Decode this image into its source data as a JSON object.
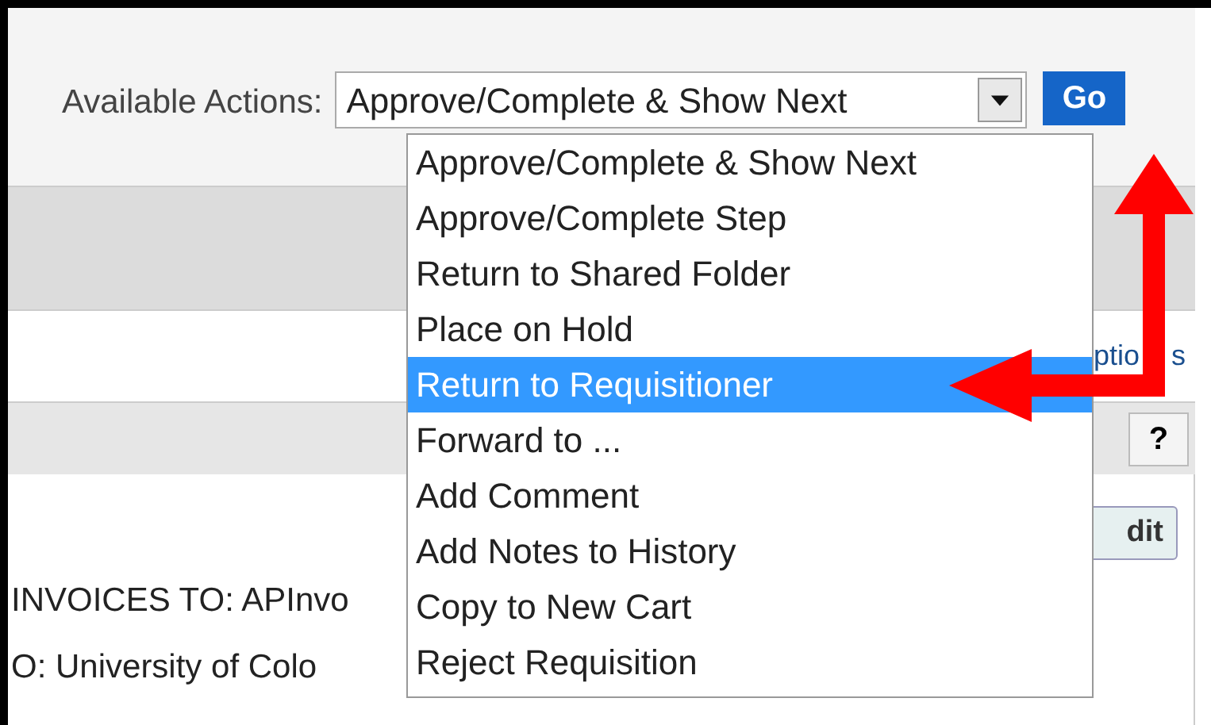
{
  "toolbar": {
    "label": "Available Actions:",
    "select": {
      "value": "Approve/Complete & Show Next"
    },
    "go_button": "Go"
  },
  "dropdown": {
    "options": [
      {
        "label": "Approve/Complete & Show Next",
        "selected": false
      },
      {
        "label": "Approve/Complete Step",
        "selected": false
      },
      {
        "label": "Return to Shared Folder",
        "selected": false
      },
      {
        "label": "Place on Hold",
        "selected": false
      },
      {
        "label": "Return to Requisitioner",
        "selected": true
      },
      {
        "label": "Forward to ...",
        "selected": false
      },
      {
        "label": "Add Comment",
        "selected": false
      },
      {
        "label": "Add Notes to History",
        "selected": false
      },
      {
        "label": "Copy to New Cart",
        "selected": false
      },
      {
        "label": "Reject Requisition",
        "selected": false
      }
    ]
  },
  "page": {
    "options_link": [
      "ptio",
      "s"
    ],
    "help_button": "?",
    "edit_button": "dit",
    "lines": [
      "INVOICES TO: APInvo",
      "O: University of Colo"
    ]
  }
}
